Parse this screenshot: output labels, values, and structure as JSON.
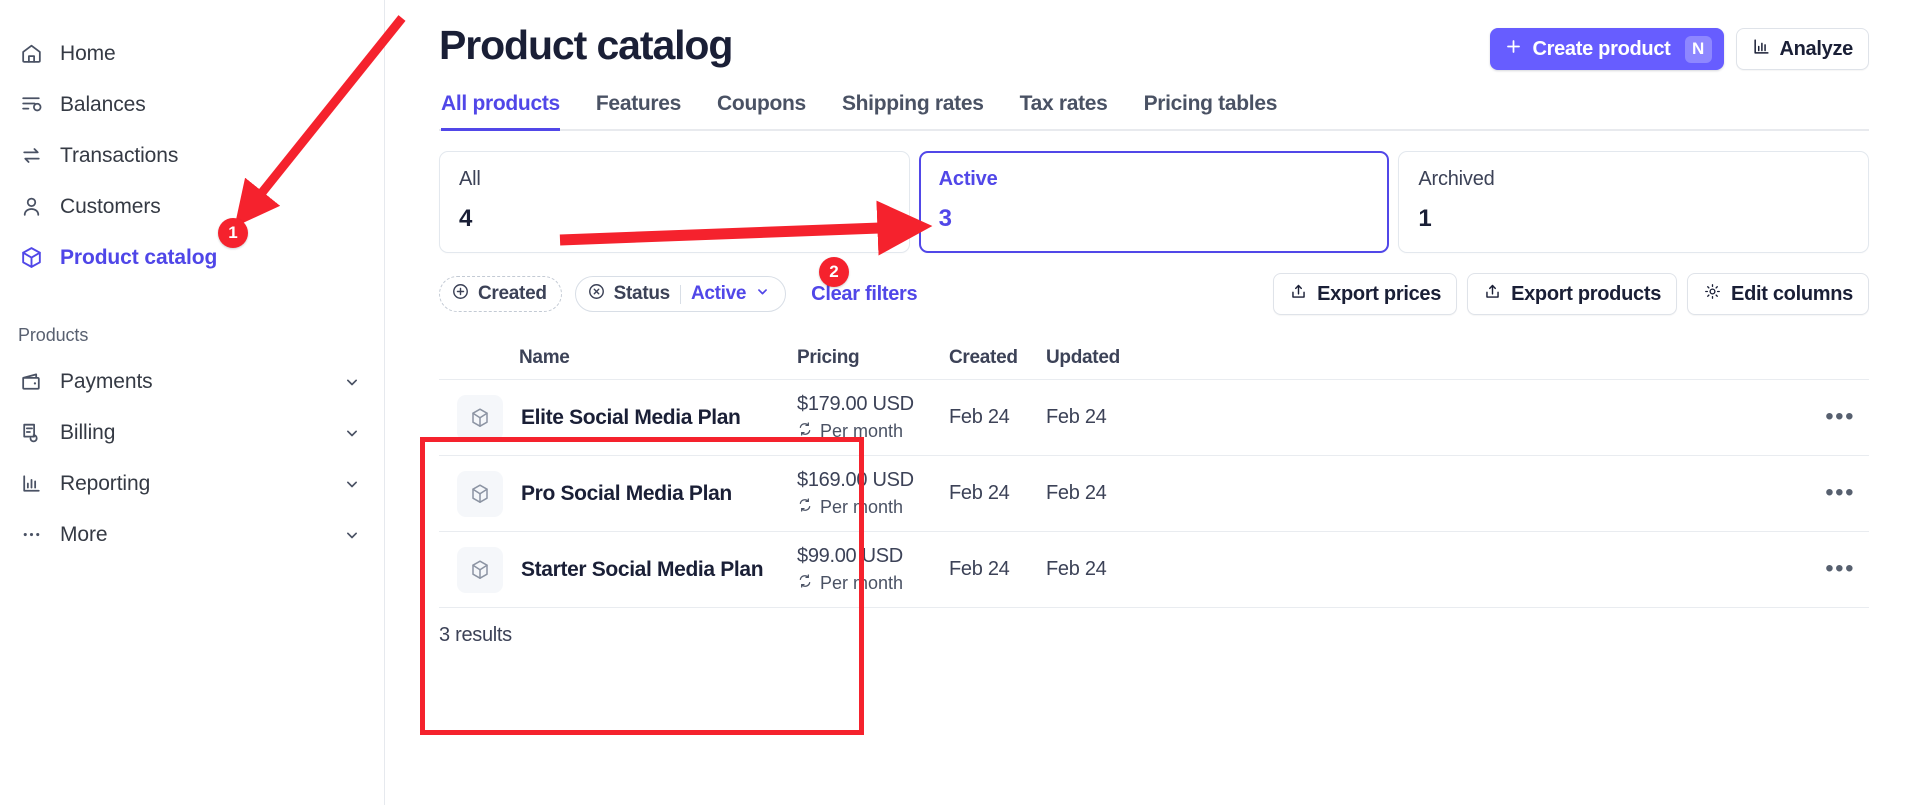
{
  "sidebar": {
    "primary_items": [
      {
        "label": "Home",
        "icon": "home-icon",
        "active": false
      },
      {
        "label": "Balances",
        "icon": "balances-icon",
        "active": false
      },
      {
        "label": "Transactions",
        "icon": "transactions-icon",
        "active": false
      },
      {
        "label": "Customers",
        "icon": "customers-icon",
        "active": false
      },
      {
        "label": "Product catalog",
        "icon": "product-catalog-icon",
        "active": true
      }
    ],
    "section_label": "Products",
    "secondary_items": [
      {
        "label": "Payments",
        "icon": "wallet-icon",
        "chevron": true
      },
      {
        "label": "Billing",
        "icon": "billing-icon",
        "chevron": true
      },
      {
        "label": "Reporting",
        "icon": "reporting-icon",
        "chevron": true
      },
      {
        "label": "More",
        "icon": "ellipsis-icon",
        "chevron": true
      }
    ]
  },
  "header": {
    "title": "Product catalog",
    "create_label": "Create product",
    "create_shortcut": "N",
    "analyze_label": "Analyze"
  },
  "tabs": [
    {
      "label": "All products",
      "active": true
    },
    {
      "label": "Features",
      "active": false
    },
    {
      "label": "Coupons",
      "active": false
    },
    {
      "label": "Shipping rates",
      "active": false
    },
    {
      "label": "Tax rates",
      "active": false
    },
    {
      "label": "Pricing tables",
      "active": false
    }
  ],
  "stat_cards": [
    {
      "label": "All",
      "value": "4",
      "selected": false
    },
    {
      "label": "Active",
      "value": "3",
      "selected": true
    },
    {
      "label": "Archived",
      "value": "1",
      "selected": false
    }
  ],
  "filters": {
    "created_chip": "Created",
    "status_chip_label": "Status",
    "status_chip_value": "Active",
    "clear_filters": "Clear filters",
    "export_prices": "Export prices",
    "export_products": "Export products",
    "edit_columns": "Edit columns"
  },
  "table": {
    "columns": [
      "Name",
      "Pricing",
      "Created",
      "Updated"
    ],
    "rows": [
      {
        "name": "Elite Social Media Plan",
        "price": "$179.00 USD",
        "interval": "Per month",
        "created": "Feb 24",
        "updated": "Feb 24"
      },
      {
        "name": "Pro Social Media Plan",
        "price": "$169.00 USD",
        "interval": "Per month",
        "created": "Feb 24",
        "updated": "Feb 24"
      },
      {
        "name": "Starter Social Media Plan",
        "price": "$99.00 USD",
        "interval": "Per month",
        "created": "Feb 24",
        "updated": "Feb 24"
      }
    ],
    "results_text": "3 results"
  },
  "annotations": {
    "marker_1": "1",
    "marker_2": "2"
  },
  "colors": {
    "accent": "#5147e8",
    "primary_button": "#675dff",
    "annotation_red": "#f5222d",
    "text": "#1a1f36"
  }
}
